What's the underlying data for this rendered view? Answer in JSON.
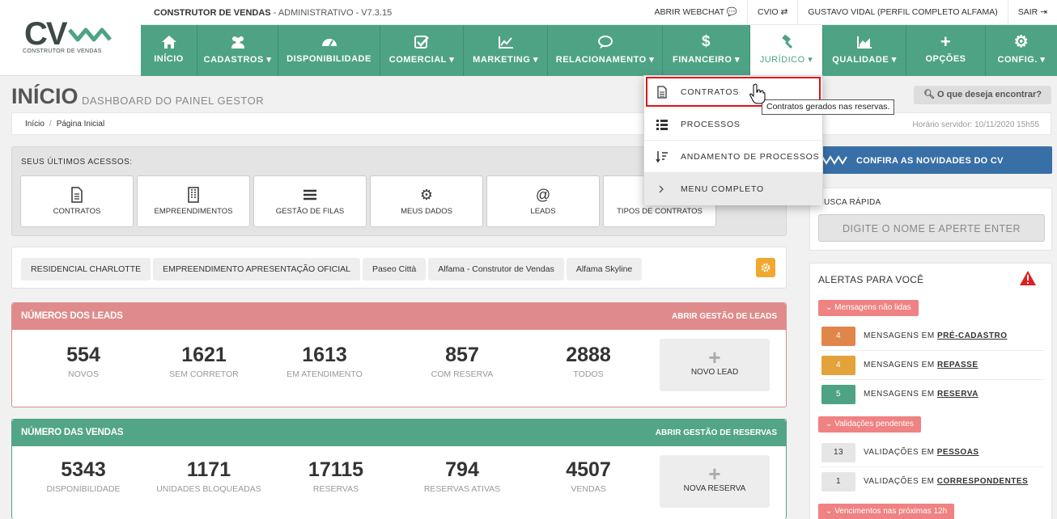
{
  "app": {
    "logo_text": "CV",
    "logo_subtitle": "CONSTRUTOR DE VENDAS",
    "title_bold": "CONSTRUTOR DE VENDAS",
    "title_rest": " - ADMINISTRATIVO - V7.3.15"
  },
  "top_links": [
    "ABRIR WEBCHAT",
    "CVIO",
    "GUSTAVO VIDAL (PERFIL COMPLETO ALFAMA)",
    "SAIR"
  ],
  "nav": {
    "items": [
      {
        "label": "INÍCIO",
        "icon": "home-icon"
      },
      {
        "label": "CADASTROS ▾",
        "icon": "users-icon"
      },
      {
        "label": "DISPONIBILIDADE",
        "icon": "gauge-icon"
      },
      {
        "label": "COMERCIAL ▾",
        "icon": "check-square-icon"
      },
      {
        "label": "MARKETING ▾",
        "icon": "chart-line-icon"
      },
      {
        "label": "RELACIONAMENTO ▾",
        "icon": "chat-icon"
      },
      {
        "label": "FINANCEIRO ▾",
        "icon": "dollar-icon"
      },
      {
        "label": "JURÍDICO ▾",
        "icon": "gavel-icon"
      },
      {
        "label": "QUALIDADE ▾",
        "icon": "chart-area-icon"
      },
      {
        "label": "OPÇÕES",
        "icon": "plus-icon"
      },
      {
        "label": "CONFIG. ▾",
        "icon": "gear-icon"
      }
    ]
  },
  "page": {
    "title": "INÍCIO",
    "subtitle": "DASHBOARD DO PAINEL GESTOR",
    "search_label": "O que deseja encontrar?",
    "breadcrumb": [
      "Início",
      "Página Inicial"
    ],
    "server_time": "Horário servidor: 10/11/2020 15h55"
  },
  "recent": {
    "title": "SEUS ÚLTIMOS ACESSOS:",
    "tiles": [
      "CONTRATOS",
      "EMPREENDIMENTOS",
      "GESTÃO DE FILAS",
      "MEUS DADOS",
      "LEADS",
      "TIPOS DE CONTRATOS"
    ]
  },
  "enterprises": [
    "RESIDENCIAL CHARLOTTE",
    "EMPREENDIMENTO APRESENTAÇÃO OFICIAL",
    "Paseo Città",
    "Alfama - Construtor de Vendas",
    "Alfama Skyline"
  ],
  "leads": {
    "title": "NÚMEROS DOS LEADS",
    "link": "ABRIR GESTÃO DE LEADS",
    "stats": [
      {
        "value": "554",
        "label": "NOVOS"
      },
      {
        "value": "1621",
        "label": "SEM CORRETOR"
      },
      {
        "value": "1613",
        "label": "EM ATENDIMENTO"
      },
      {
        "value": "857",
        "label": "COM RESERVA"
      },
      {
        "value": "2888",
        "label": "TODOS"
      }
    ],
    "button": "NOVO LEAD"
  },
  "sales": {
    "title": "NÚMERO DAS VENDAS",
    "link": "ABRIR GESTÃO DE RESERVAS",
    "stats": [
      {
        "value": "5343",
        "label": "DISPONIBILIDADE"
      },
      {
        "value": "1171",
        "label": "UNIDADES BLOQUEADAS"
      },
      {
        "value": "17115",
        "label": "RESERVAS"
      },
      {
        "value": "794",
        "label": "RESERVAS ATIVAS"
      },
      {
        "value": "4507",
        "label": "VENDAS"
      }
    ],
    "button": "NOVA RESERVA"
  },
  "news": {
    "label": "CONFIRA AS NOVIDADES DO CV"
  },
  "quick_search": {
    "title": "BUSCA RÁPIDA",
    "placeholder": "DIGITE O NOME E APERTE ENTER"
  },
  "alerts": {
    "title": "ALERTAS PARA VOCÊ",
    "groups": [
      {
        "label": "Mensagens não lidas"
      },
      {
        "label": "Validações pendentes"
      },
      {
        "label": "Vencimentos nas próximas 12h"
      }
    ],
    "rows": [
      {
        "count": "4",
        "prefix": "MENSAGENS EM ",
        "link": "PRÉ-CADASTRO",
        "color": "#e0864a"
      },
      {
        "count": "4",
        "prefix": "MENSAGENS EM ",
        "link": "REPASSE",
        "color": "#e3a23a"
      },
      {
        "count": "5",
        "prefix": "MENSAGENS EM ",
        "link": "RESERVA",
        "color": "#4ea384"
      },
      {
        "count": "13",
        "prefix": "VALIDAÇÕES EM ",
        "link": "PESSOAS",
        "color": "#e6e6e6"
      },
      {
        "count": "1",
        "prefix": "VALIDAÇÕES EM ",
        "link": "CORRESPONDENTES",
        "color": "#e6e6e6"
      }
    ]
  },
  "dropdown": {
    "items": [
      {
        "label": "CONTRATOS",
        "icon": "document-icon"
      },
      {
        "label": "PROCESSOS",
        "icon": "list-icon"
      },
      {
        "label": "ANDAMENTO DE PROCESSOS",
        "icon": "sort-icon"
      },
      {
        "label": "MENU COMPLETO",
        "icon": "chevron-right-icon"
      }
    ],
    "tooltip": "Contratos gerados nas reservas."
  },
  "colors": {
    "brand_green": "#4ea384",
    "leads_red": "#df8b8b",
    "news_blue": "#386fa6",
    "highlight_red": "#e0101a"
  }
}
